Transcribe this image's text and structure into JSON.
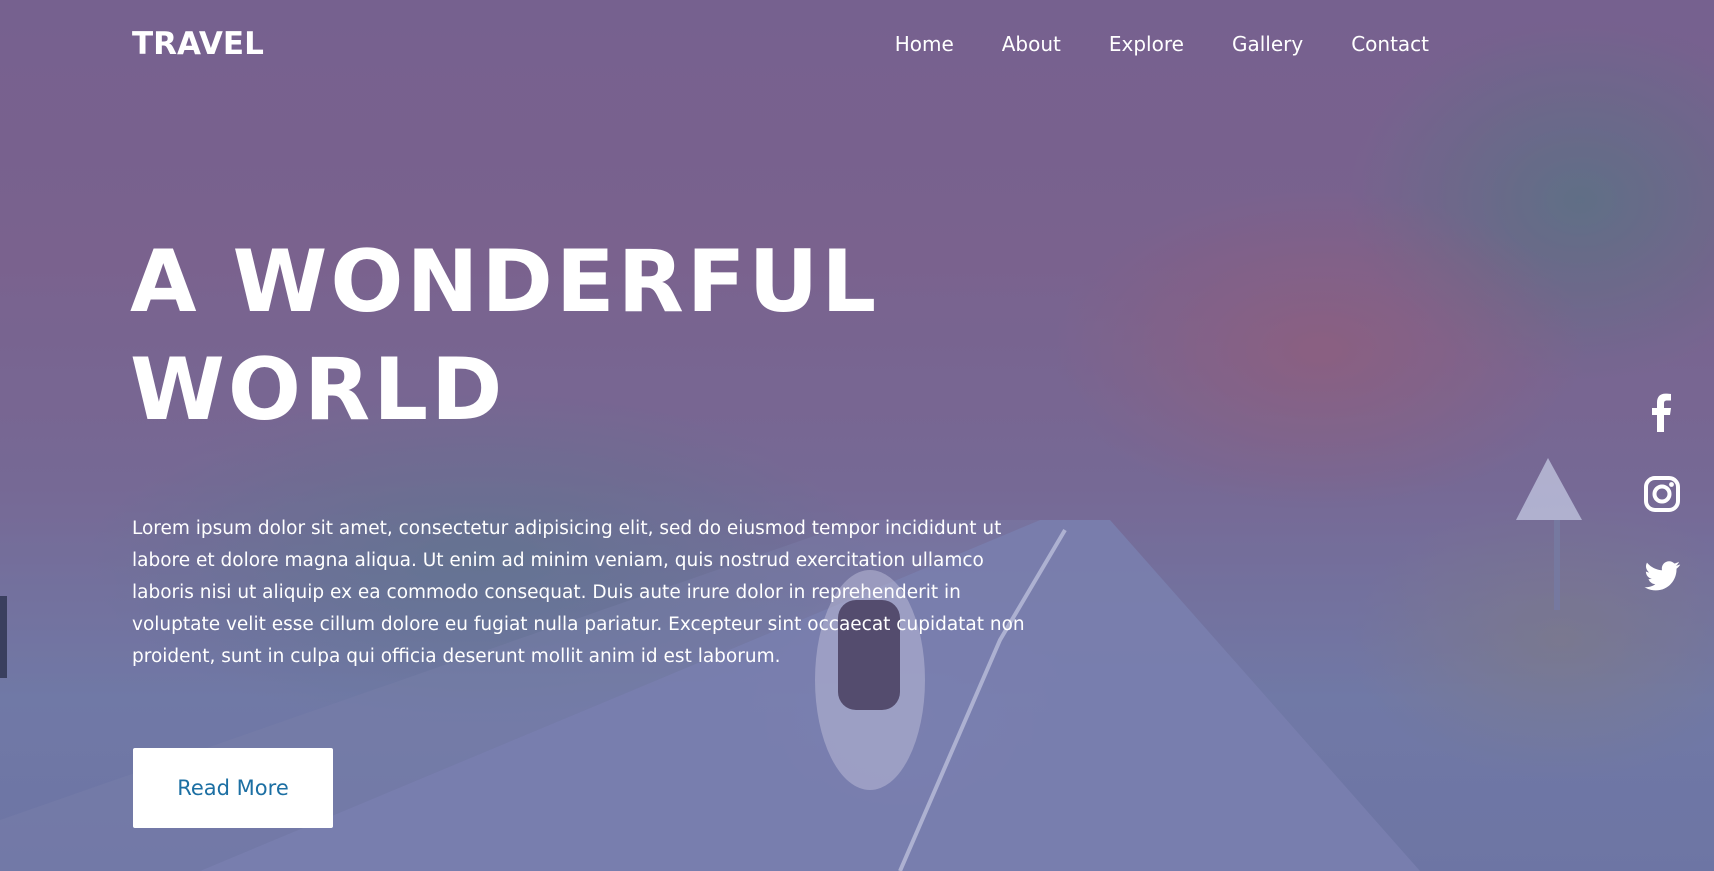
{
  "nav": {
    "logo": "TRAVEL",
    "items": [
      "Home",
      "About",
      "Explore",
      "Gallery",
      "Contact"
    ]
  },
  "hero": {
    "title_line1": "A WONDERFUL",
    "title_line2": "WORLD",
    "description": "Lorem ipsum dolor sit amet, consectetur adipisicing elit, sed do eiusmod tempor incididunt ut labore et dolore magna aliqua. Ut enim ad minim veniam, quis nostrud exercitation ullamco laboris nisi ut aliquip ex ea commodo consequat. Duis aute irure dolor in reprehenderit in voluptate velit esse cillum dolore eu fugiat nulla pariatur. Excepteur sint occaecat cupidatat non proident, sunt in culpa qui officia deserunt mollit anim id est laborum.",
    "button_label": "Read More"
  },
  "social": {
    "icons": [
      "facebook-icon",
      "instagram-icon",
      "twitter-icon"
    ]
  },
  "colors": {
    "overlay": "#4650a0",
    "button_text": "#1c6fa3",
    "text": "#ffffff"
  }
}
